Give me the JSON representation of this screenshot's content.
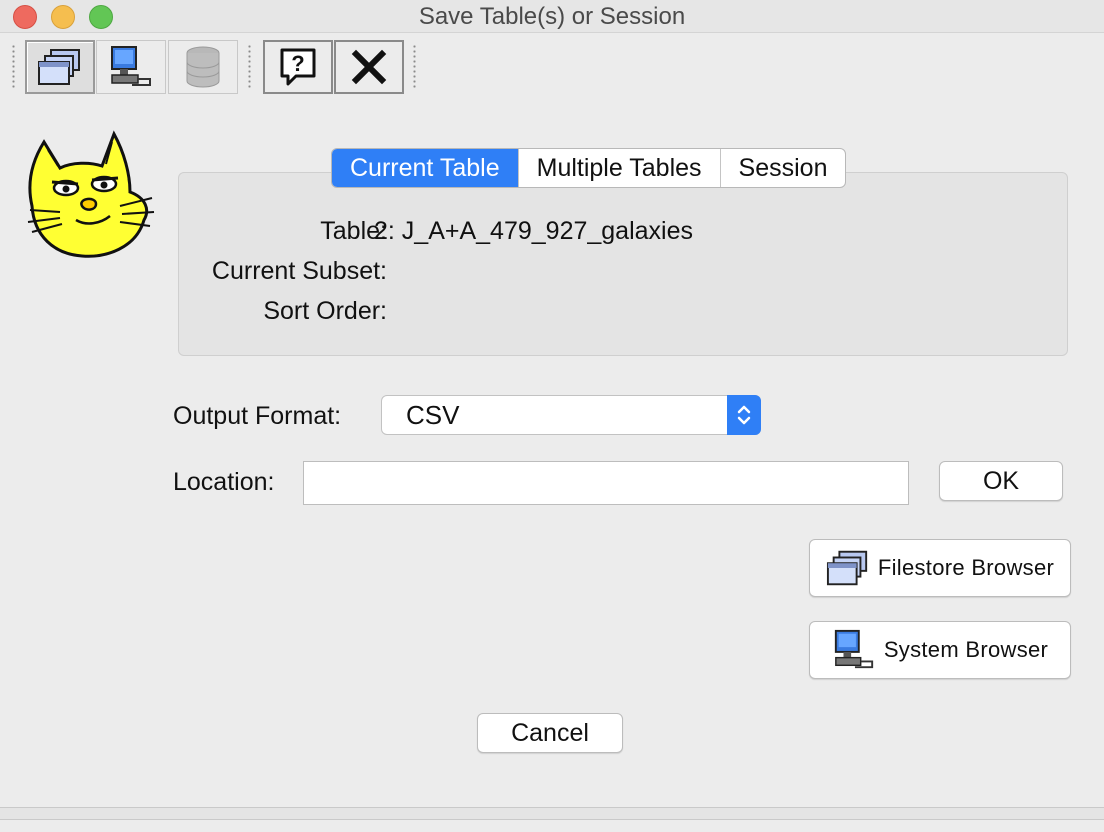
{
  "window": {
    "title": "Save Table(s) or Session"
  },
  "toolbar": {
    "buttons": [
      {
        "name": "filestore-browser-tool",
        "icon": "folder-icon"
      },
      {
        "name": "system-browser-tool",
        "icon": "computer-icon"
      },
      {
        "name": "database-tool",
        "icon": "database-icon"
      },
      {
        "name": "help-tool",
        "icon": "help-icon"
      },
      {
        "name": "close-tool",
        "icon": "close-icon"
      }
    ]
  },
  "tabs": [
    {
      "label": "Current Table",
      "active": true
    },
    {
      "label": "Multiple Tables",
      "active": false
    },
    {
      "label": "Session",
      "active": false
    }
  ],
  "panel": {
    "table_label": "Table:",
    "table_value": "2: J_A+A_479_927_galaxies",
    "subset_label": "Current Subset:",
    "subset_value": "",
    "sort_label": "Sort Order:",
    "sort_value": ""
  },
  "form": {
    "output_format_label": "Output Format:",
    "output_format_value": "CSV",
    "location_label": "Location:",
    "location_value": "",
    "ok_label": "OK",
    "filestore_label": "Filestore Browser",
    "system_label": "System Browser",
    "cancel_label": "Cancel"
  },
  "colors": {
    "accent": "#2f7ff6",
    "logo_yellow": "#ffff33"
  }
}
